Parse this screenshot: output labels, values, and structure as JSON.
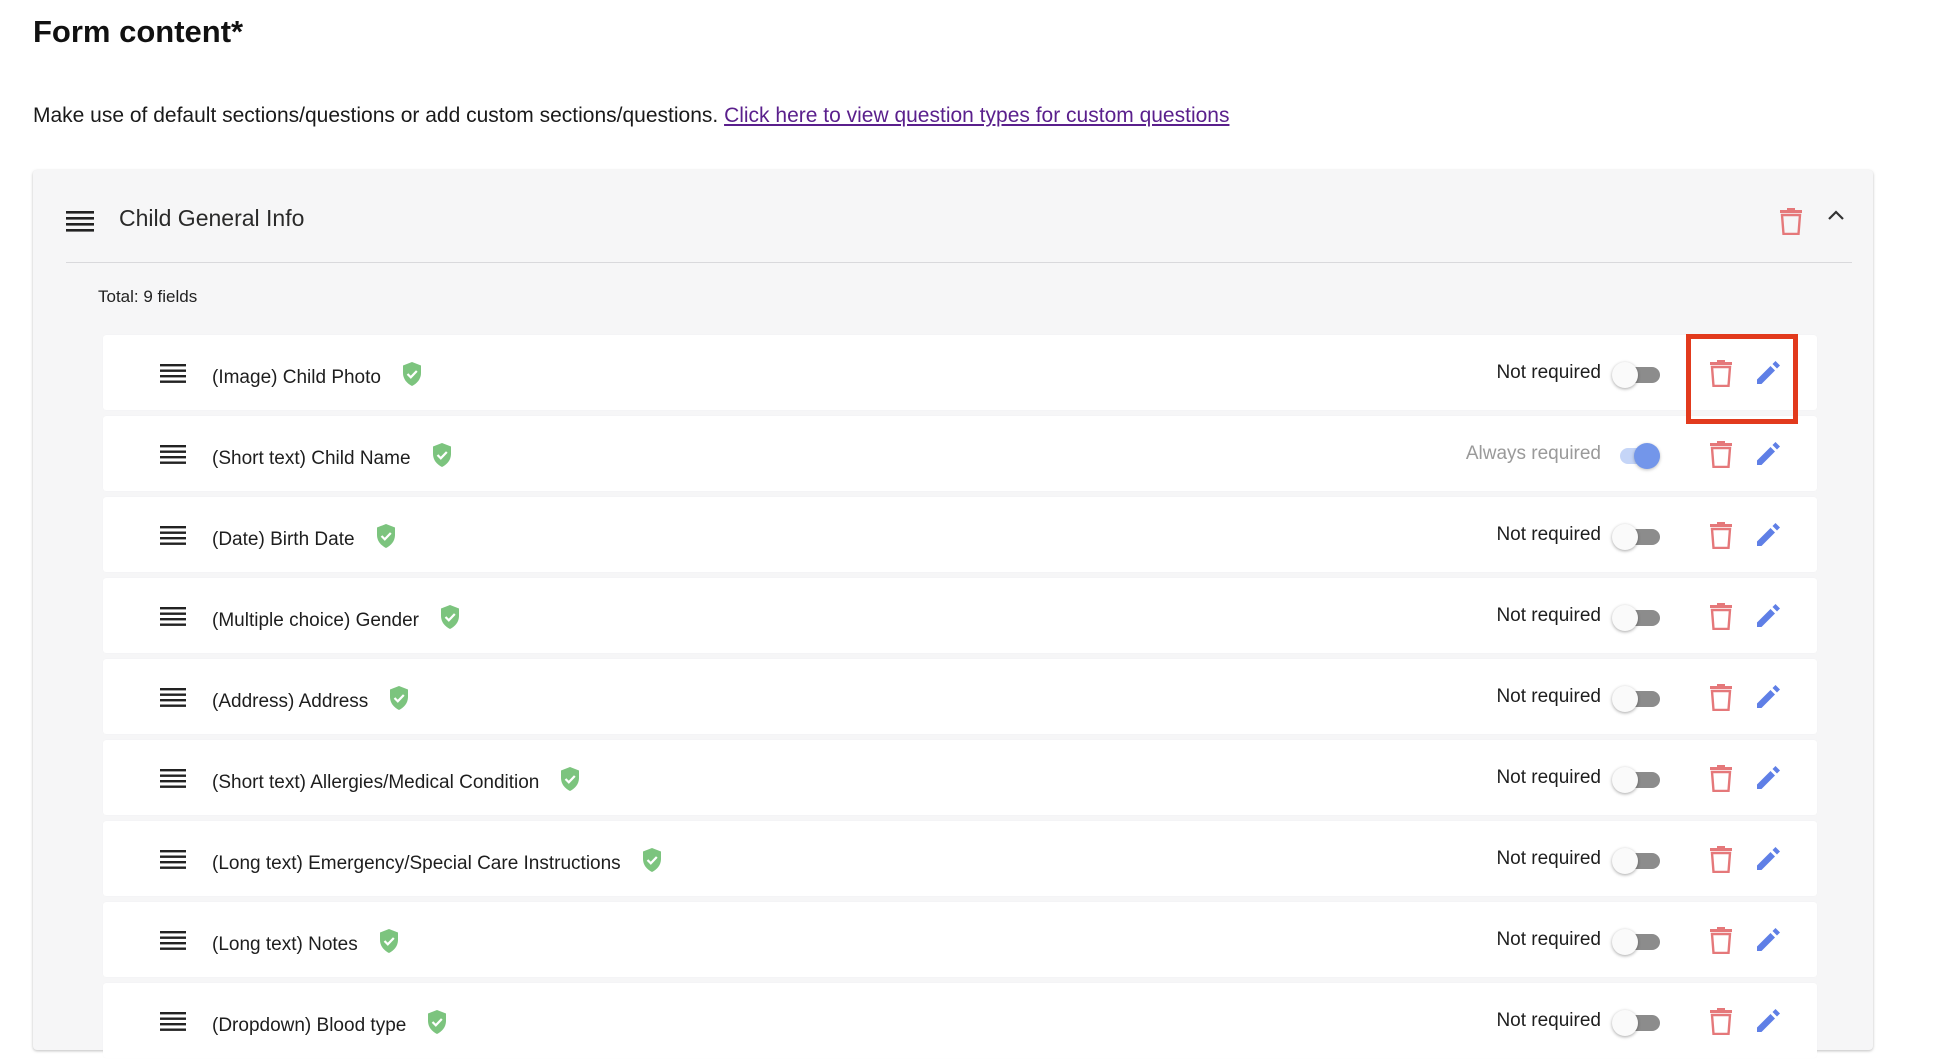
{
  "page": {
    "title": "Form content*",
    "intro_text": "Make use of default sections/questions or add custom sections/questions.",
    "intro_link": "Click here to view question types for custom questions"
  },
  "section": {
    "title": "Child General Info",
    "total": "Total: 9 fields",
    "icons": {
      "drag": "drag-handle-icon",
      "delete": "trash-icon",
      "collapse": "chevron-up-icon"
    }
  },
  "colors": {
    "delete": "#e5787a",
    "edit": "#5f7fe6",
    "shield": "#7cc47e",
    "highlight": "#e23a1d",
    "toggle_on": "#7396ea"
  },
  "fields": [
    {
      "label": "(Image) Child Photo",
      "requirement": "Not required",
      "toggle_on": false,
      "always": false
    },
    {
      "label": "(Short text) Child Name",
      "requirement": "Always required",
      "toggle_on": true,
      "always": true
    },
    {
      "label": "(Date) Birth Date",
      "requirement": "Not required",
      "toggle_on": false,
      "always": false
    },
    {
      "label": "(Multiple choice) Gender",
      "requirement": "Not required",
      "toggle_on": false,
      "always": false
    },
    {
      "label": "(Address) Address",
      "requirement": "Not required",
      "toggle_on": false,
      "always": false
    },
    {
      "label": "(Short text) Allergies/Medical Condition",
      "requirement": "Not required",
      "toggle_on": false,
      "always": false
    },
    {
      "label": "(Long text) Emergency/Special Care Instructions",
      "requirement": "Not required",
      "toggle_on": false,
      "always": false
    },
    {
      "label": "(Long text) Notes",
      "requirement": "Not required",
      "toggle_on": false,
      "always": false
    },
    {
      "label": "(Dropdown) Blood type",
      "requirement": "Not required",
      "toggle_on": false,
      "always": false
    }
  ]
}
